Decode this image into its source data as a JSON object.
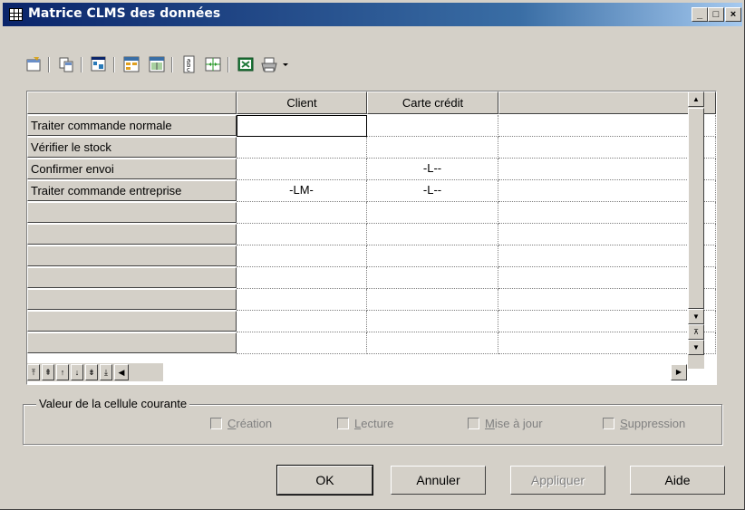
{
  "window": {
    "title": "Matrice CLMS des données",
    "controls": {
      "minimize": "_",
      "maximize": "□",
      "close": "×"
    }
  },
  "toolbar": {
    "buttons": [
      "properties-icon",
      "copy-icon",
      "find-icon",
      "add-columns-icon",
      "matrix-icon",
      "text-orientation-icon",
      "grid-icon",
      "excel-icon",
      "print-icon",
      "dropdown-arrow-icon"
    ]
  },
  "matrix": {
    "columns": [
      "Client",
      "Carte crédit",
      ""
    ],
    "rows": [
      {
        "label": "Traiter commande normale",
        "cells": [
          "",
          "",
          ""
        ]
      },
      {
        "label": "Vérifier le stock",
        "cells": [
          "",
          "",
          ""
        ]
      },
      {
        "label": "Confirmer envoi",
        "cells": [
          "",
          "-L--",
          ""
        ]
      },
      {
        "label": "Traiter commande entreprise",
        "cells": [
          "-LM-",
          "-L--",
          ""
        ]
      },
      {
        "label": "",
        "cells": [
          "",
          "",
          ""
        ]
      },
      {
        "label": "",
        "cells": [
          "",
          "",
          ""
        ]
      },
      {
        "label": "",
        "cells": [
          "",
          "",
          ""
        ]
      },
      {
        "label": "",
        "cells": [
          "",
          "",
          ""
        ]
      },
      {
        "label": "",
        "cells": [
          "",
          "",
          ""
        ]
      },
      {
        "label": "",
        "cells": [
          "",
          "",
          ""
        ]
      },
      {
        "label": "",
        "cells": [
          "",
          "",
          ""
        ]
      }
    ]
  },
  "current_cell": {
    "title": "Valeur de la cellule courante",
    "checkboxes": [
      {
        "access": "C",
        "rest": "réation",
        "checked": false,
        "enabled": false
      },
      {
        "access": "L",
        "rest": "ecture",
        "checked": false,
        "enabled": false
      },
      {
        "access": "M",
        "rest": "ise à jour",
        "checked": false,
        "enabled": false
      },
      {
        "access": "S",
        "rest": "uppression",
        "checked": false,
        "enabled": false
      }
    ]
  },
  "buttons": {
    "ok": "OK",
    "cancel": "Annuler",
    "apply": "Appliquer",
    "help": "Aide"
  }
}
